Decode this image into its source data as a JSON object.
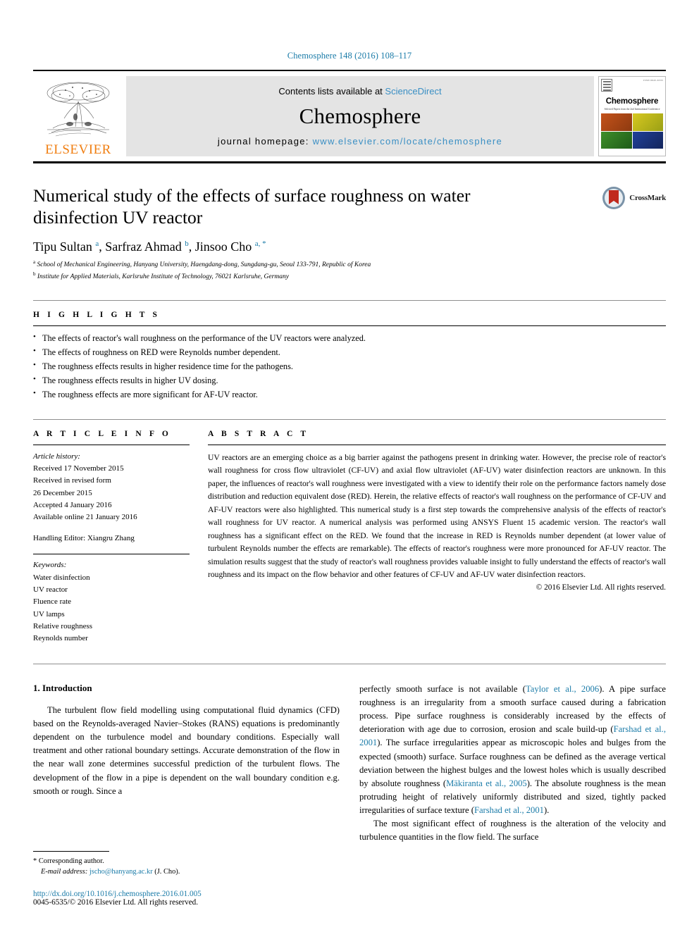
{
  "running_head": "Chemosphere 148 (2016) 108–117",
  "masthead": {
    "publisher": "ELSEVIER",
    "contents_prefix": "Contents lists available at ",
    "contents_link": "ScienceDirect",
    "journal_title": "Chemosphere",
    "homepage_label": "journal homepage: ",
    "homepage_url": "www.elsevier.com/locate/chemosphere",
    "cover": {
      "journal_name": "Chemosphere",
      "tagline": "Selected Papers from the 2nd International Conference",
      "code": "ISSN 0045-6535"
    }
  },
  "article": {
    "title": "Numerical study of the effects of surface roughness on water disinfection UV reactor",
    "authors_html": "Tipu Sultan <sup>a</sup>, Sarfraz Ahmad <sup>b</sup>, Jinsoo Cho <sup>a, *</sup>",
    "affiliations": [
      {
        "marker": "a",
        "text": "School of Mechanical Engineering, Hanyang University, Haengdang-dong, Sungdang-gu, Seoul 133-791, Republic of Korea"
      },
      {
        "marker": "b",
        "text": "Institute for Applied Materials, Karlsruhe Institute of Technology, 76021 Karlsruhe, Germany"
      }
    ],
    "crossmark_label": "CrossMark"
  },
  "highlights": {
    "heading": "H I G H L I G H T S",
    "items": [
      "The effects of reactor's wall roughness on the performance of the UV reactors were analyzed.",
      "The effects of roughness on RED were Reynolds number dependent.",
      "The roughness effects results in higher residence time for the pathogens.",
      "The roughness effects results in higher UV dosing.",
      "The roughness effects are more significant for AF-UV reactor."
    ]
  },
  "article_info": {
    "heading": "A R T I C L E   I N F O",
    "history_label": "Article history:",
    "history": [
      "Received 17 November 2015",
      "Received in revised form",
      "26 December 2015",
      "Accepted 4 January 2016",
      "Available online 21 January 2016"
    ],
    "handling_editor": "Handling Editor: Xiangru Zhang",
    "keywords_label": "Keywords:",
    "keywords": [
      "Water disinfection",
      "UV reactor",
      "Fluence rate",
      "UV lamps",
      "Relative roughness",
      "Reynolds number"
    ]
  },
  "abstract": {
    "heading": "A B S T R A C T",
    "text": "UV reactors are an emerging choice as a big barrier against the pathogens present in drinking water. However, the precise role of reactor's wall roughness for cross flow ultraviolet (CF-UV) and axial flow ultraviolet (AF-UV) water disinfection reactors are unknown. In this paper, the influences of reactor's wall roughness were investigated with a view to identify their role on the performance factors namely dose distribution and reduction equivalent dose (RED). Herein, the relative effects of reactor's wall roughness on the performance of CF-UV and AF-UV reactors were also highlighted. This numerical study is a first step towards the comprehensive analysis of the effects of reactor's wall roughness for UV reactor. A numerical analysis was performed using ANSYS Fluent 15 academic version. The reactor's wall roughness has a significant effect on the RED. We found that the increase in RED is Reynolds number dependent (at lower value of turbulent Reynolds number the effects are remarkable). The effects of reactor's roughness were more pronounced for AF-UV reactor. The simulation results suggest that the study of reactor's wall roughness provides valuable insight to fully understand the effects of reactor's wall roughness and its impact on the flow behavior and other features of CF-UV and AF-UV water disinfection reactors.",
    "copyright": "© 2016 Elsevier Ltd. All rights reserved."
  },
  "introduction": {
    "heading": "1. Introduction",
    "left_paragraph": "The turbulent flow field modelling using computational fluid dynamics (CFD) based on the Reynolds-averaged Navier–Stokes (RANS) equations is predominantly dependent on the turbulence model and boundary conditions. Especially wall treatment and other rational boundary settings. Accurate demonstration of the flow in the near wall zone determines successful prediction of the turbulent flows. The development of the flow in a pipe is dependent on the wall boundary condition e.g. smooth or rough. Since a",
    "right_paragraph_1_pre": "perfectly smooth surface is not available (",
    "right_cite_1": "Taylor et al., 2006",
    "right_paragraph_1_mid": "). A pipe surface roughness is an irregularity from a smooth surface caused during a fabrication process. Pipe surface roughness is considerably increased by the effects of deterioration with age due to corrosion, erosion and scale build-up (",
    "right_cite_2": "Farshad et al., 2001",
    "right_paragraph_1_mid2": "). The surface irregularities appear as microscopic holes and bulges from the expected (smooth) surface. Surface roughness can be defined as the average vertical deviation between the highest bulges and the lowest holes which is usually described by absolute roughness (",
    "right_cite_3": "Mäkiranta et al., 2005",
    "right_paragraph_1_mid3": "). The absolute roughness is the mean protruding height of relatively uniformly distributed and sized, tightly packed irregularities of surface texture (",
    "right_cite_4": "Farshad et al., 2001",
    "right_paragraph_1_end": ").",
    "right_paragraph_2": "The most significant effect of roughness is the alteration of the velocity and turbulence quantities in the flow field. The surface"
  },
  "footer": {
    "corresponding_marker": "*",
    "corresponding_label": "Corresponding author.",
    "email_label": "E-mail address:",
    "email": "jscho@hanyang.ac.kr",
    "email_suffix": "(J. Cho).",
    "doi": "http://dx.doi.org/10.1016/j.chemosphere.2016.01.005",
    "issn_line": "0045-6535/© 2016 Elsevier Ltd. All rights reserved."
  },
  "colors": {
    "link": "#1a7ba8",
    "elsevier_orange": "#f07f13",
    "banner_bg": "#e4e4e4"
  }
}
